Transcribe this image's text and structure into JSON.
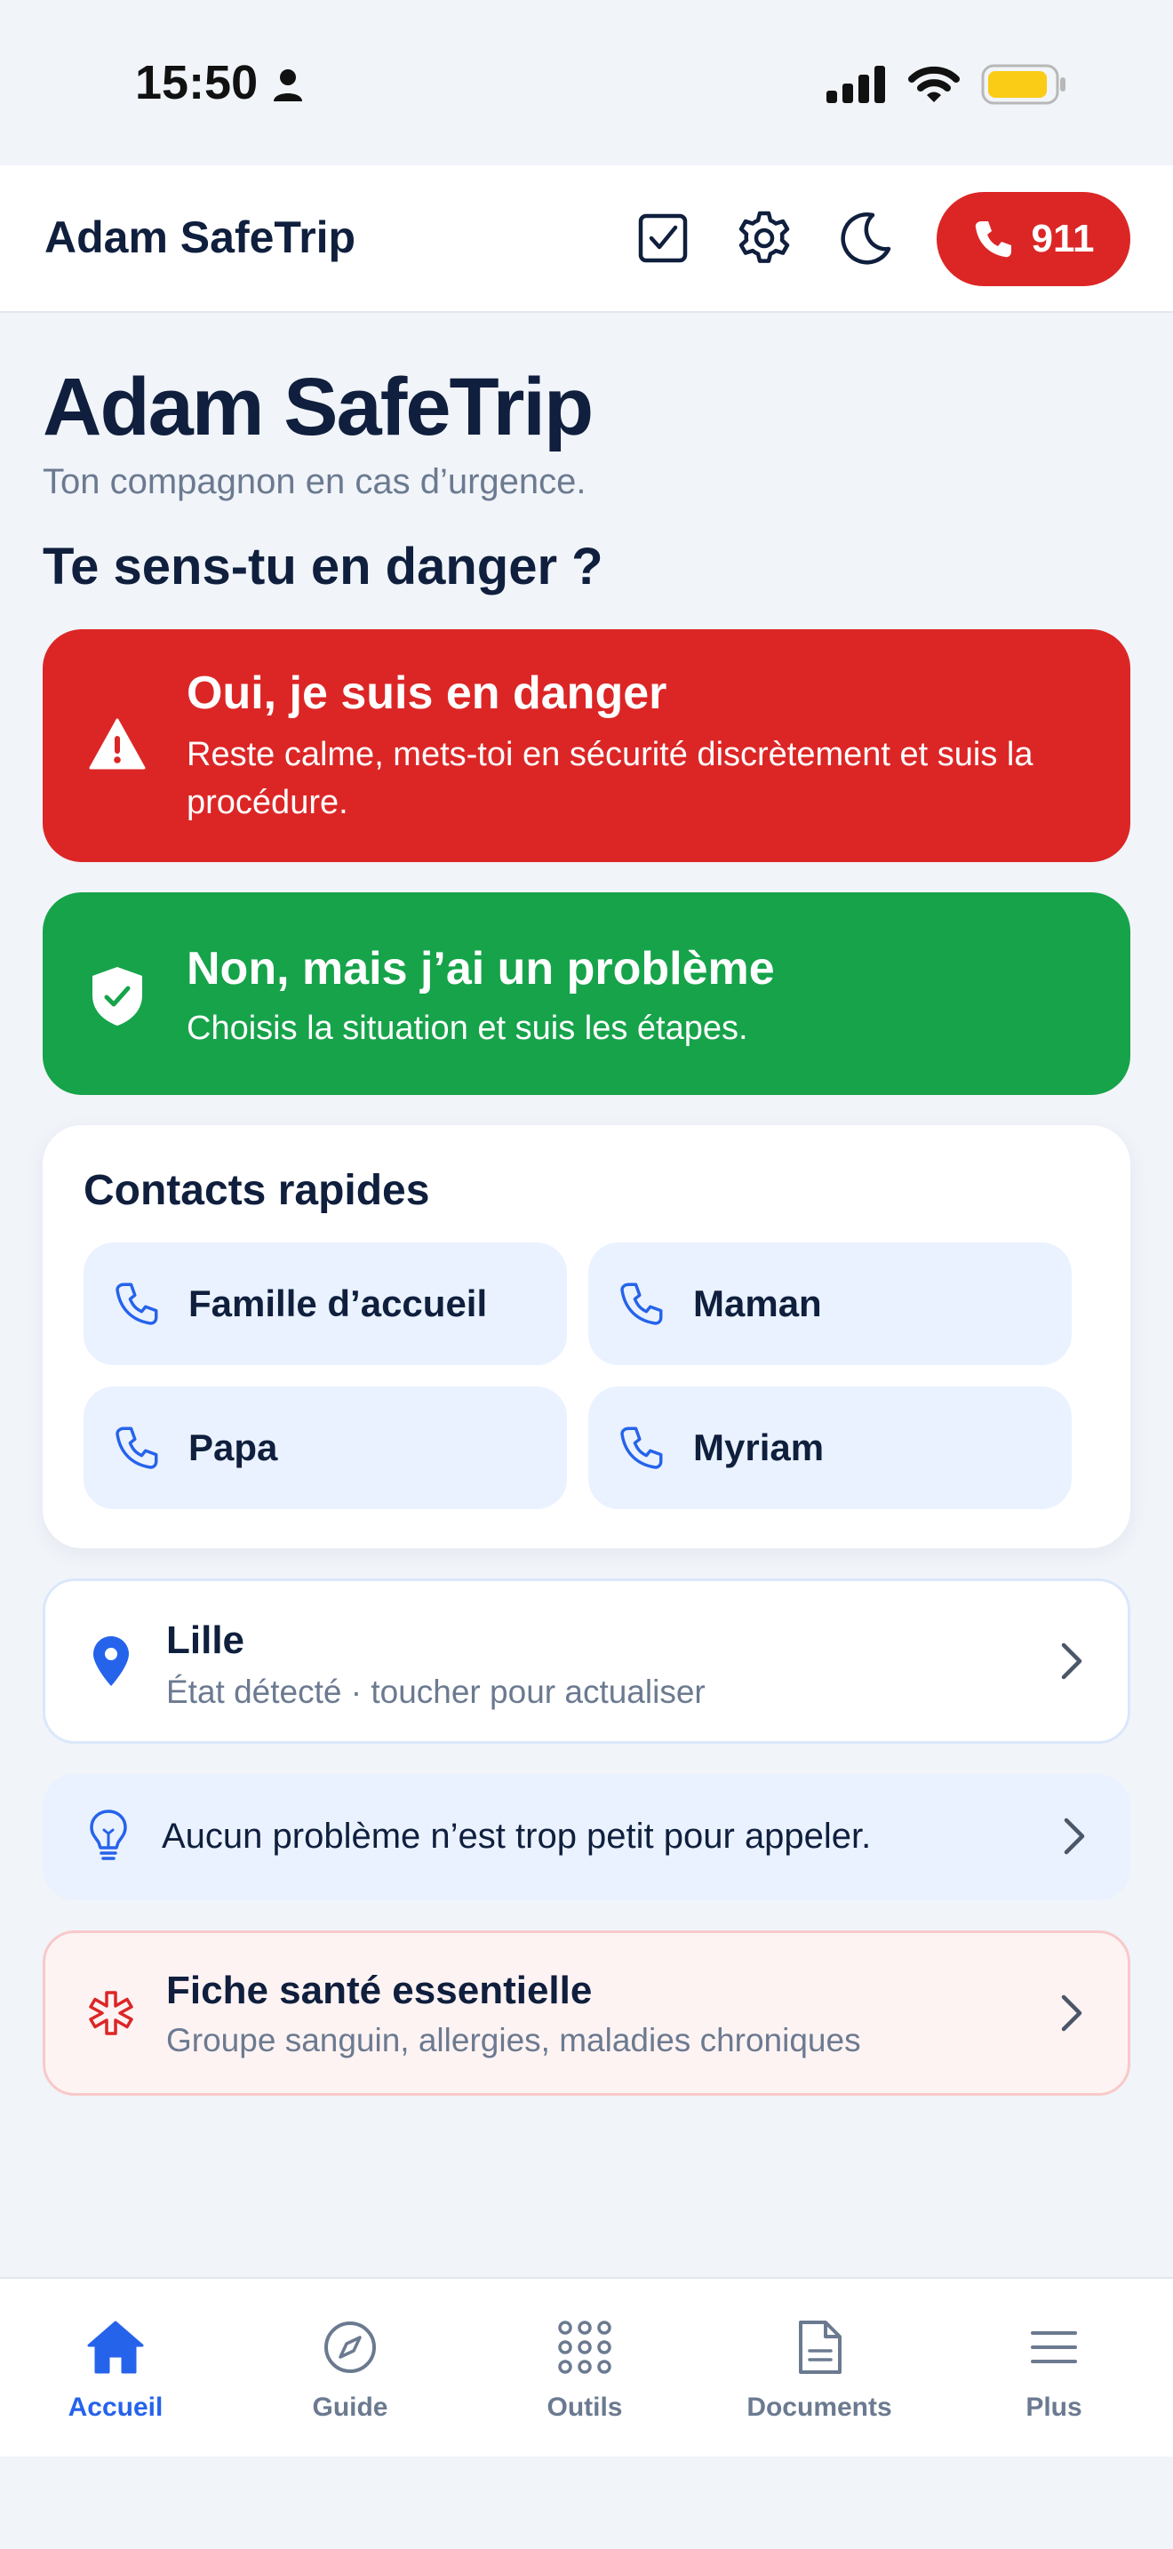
{
  "status_bar": {
    "time": "15:50",
    "battery_color": "#facc15"
  },
  "app_bar": {
    "title": "Adam SafeTrip",
    "icons": [
      "checkbox-icon",
      "gear-icon",
      "moon-icon"
    ],
    "emergency_button": {
      "label": "911",
      "color": "#dc2626"
    }
  },
  "hero": {
    "title": "Adam SafeTrip",
    "subtitle": "Ton compagnon en cas d’urgence.",
    "question": "Te sens-tu en danger ?"
  },
  "danger_card": {
    "title": "Oui, je suis en danger",
    "description": "Reste calme, mets-toi en sécurité discrètement et suis la procédure.",
    "color": "#dc2626"
  },
  "ok_card": {
    "title": "Non, mais j’ai un problème",
    "description": "Choisis la situation et suis les étapes.",
    "color": "#16a34a"
  },
  "contacts": {
    "title": "Contacts rapides",
    "items": [
      {
        "label": "Famille d’accueil"
      },
      {
        "label": "Maman"
      },
      {
        "label": "Papa"
      },
      {
        "label": "Myriam"
      }
    ]
  },
  "location": {
    "title": "Lille",
    "subtitle": "État détecté · toucher pour actualiser"
  },
  "tip": {
    "text": "Aucun problème n’est trop petit pour appeler."
  },
  "health": {
    "title": "Fiche santé essentielle",
    "subtitle": "Groupe sanguin, allergies, maladies chroniques"
  },
  "tabs": [
    {
      "label": "Accueil",
      "icon": "home-icon",
      "active": true
    },
    {
      "label": "Guide",
      "icon": "compass-icon",
      "active": false
    },
    {
      "label": "Outils",
      "icon": "grid-icon",
      "active": false
    },
    {
      "label": "Documents",
      "icon": "document-icon",
      "active": false
    },
    {
      "label": "Plus",
      "icon": "menu-icon",
      "active": false
    }
  ],
  "colors": {
    "accent": "#2563eb",
    "background": "#f1f4f9",
    "text": "#0f1f3d"
  }
}
